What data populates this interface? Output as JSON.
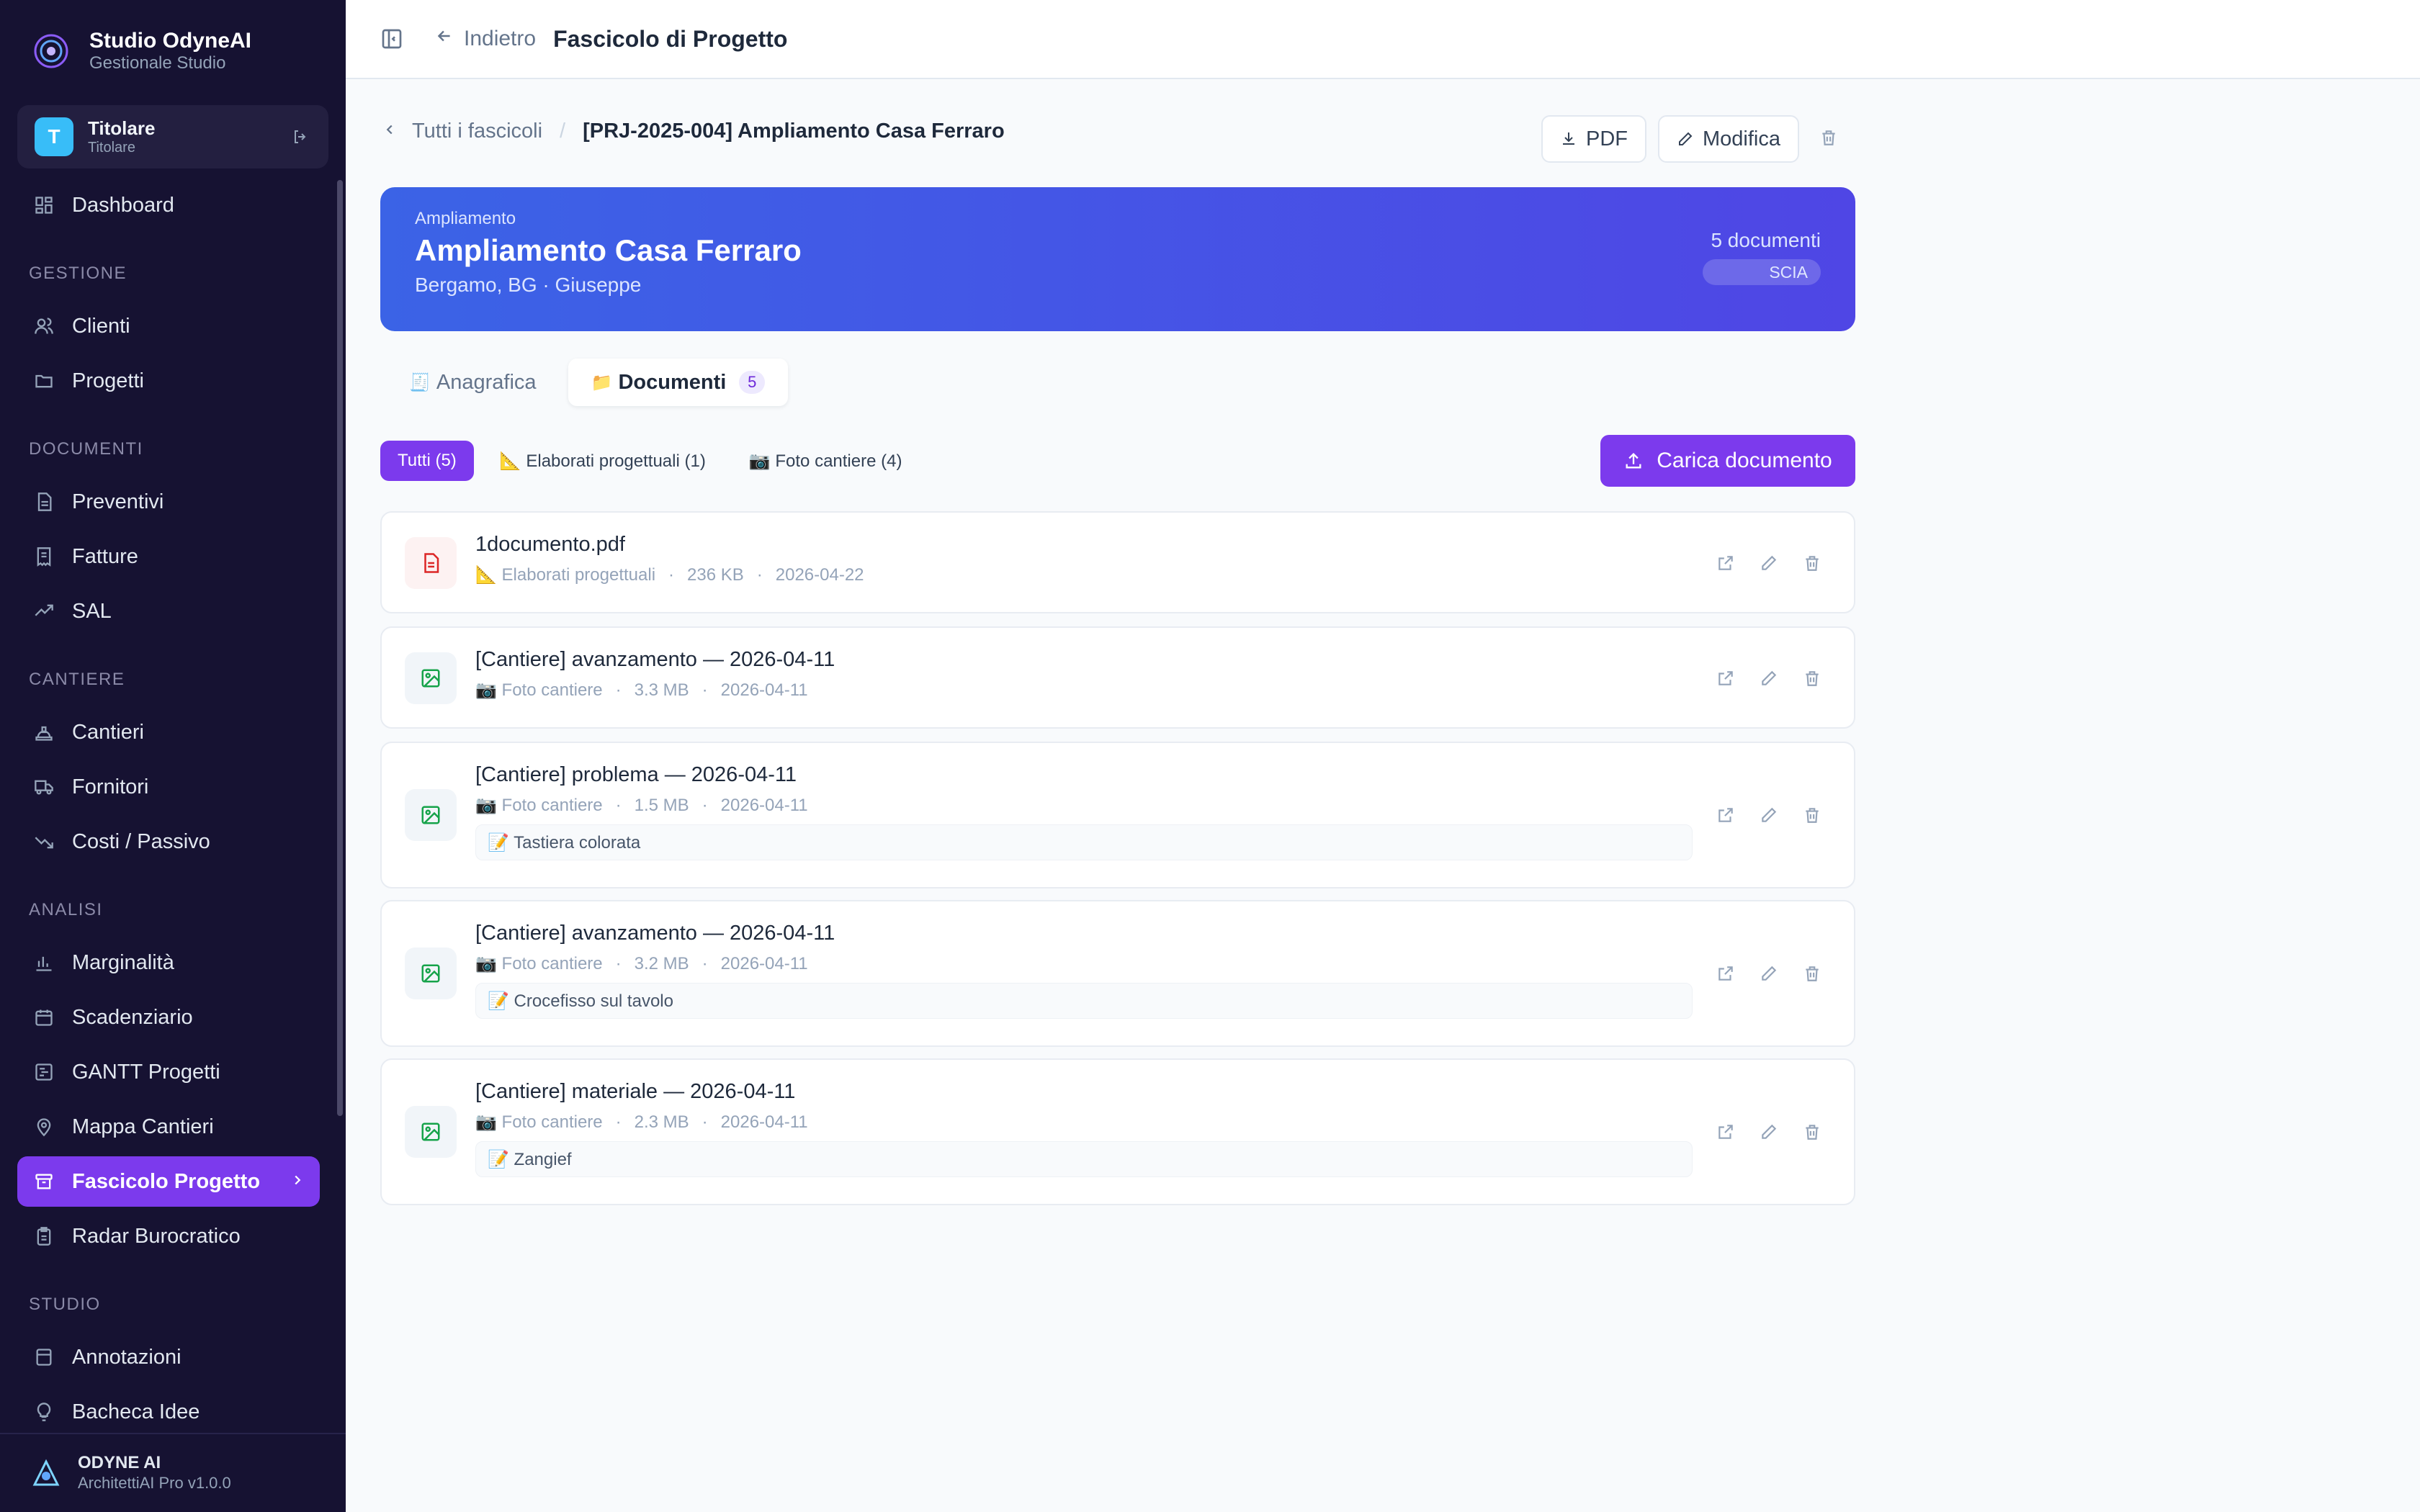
{
  "brand": {
    "name": "Studio OdyneAI",
    "subtitle": "Gestionale Studio"
  },
  "user": {
    "initial": "T",
    "name": "Titolare",
    "role": "Titolare"
  },
  "nav": {
    "dashboard": "Dashboard",
    "section_gestione": "GESTIONE",
    "clienti": "Clienti",
    "progetti": "Progetti",
    "section_documenti": "DOCUMENTI",
    "preventivi": "Preventivi",
    "fatture": "Fatture",
    "sal": "SAL",
    "section_cantiere": "CANTIERE",
    "cantieri": "Cantieri",
    "fornitori": "Fornitori",
    "costi": "Costi / Passivo",
    "section_analisi": "ANALISI",
    "marginalita": "Marginalità",
    "scadenziario": "Scadenziario",
    "gantt": "GANTT Progetti",
    "mappa": "Mappa Cantieri",
    "fascicolo": "Fascicolo Progetto",
    "radar": "Radar Burocratico",
    "section_studio": "STUDIO",
    "annotazioni": "Annotazioni",
    "bacheca": "Bacheca Idee"
  },
  "footer": {
    "name": "ODYNE AI",
    "version": "ArchitettiAI Pro v1.0.0"
  },
  "topbar": {
    "back_label": "Indietro",
    "title": "Fascicolo di Progetto"
  },
  "breadcrumb": {
    "back": "Tutti i fascicoli",
    "separator": "/",
    "current": "[PRJ-2025-004] Ampliamento Casa Ferraro"
  },
  "actions": {
    "pdf": "PDF",
    "edit": "Modifica"
  },
  "hero": {
    "type": "Ampliamento",
    "title": "Ampliamento Casa Ferraro",
    "location": "Bergamo, BG · Giuseppe",
    "count": "5 documenti",
    "badge": "SCIA"
  },
  "tabs": {
    "anagrafica": {
      "emoji": "🧾",
      "label": "Anagrafica"
    },
    "documenti": {
      "emoji": "📁",
      "label": "Documenti",
      "count": "5"
    }
  },
  "filters": {
    "all": "Tutti (5)",
    "elaborati": "📐 Elaborati progettuali (1)",
    "foto": "📷 Foto cantiere (4)"
  },
  "upload_label": "Carica documento",
  "documents": [
    {
      "title": "1documento.pdf",
      "category": "📐 Elaborati progettuali",
      "size": "236 KB",
      "date": "2026-04-22",
      "note": ""
    },
    {
      "title": "[Cantiere] avanzamento — 2026-04-11",
      "category": "📷 Foto cantiere",
      "size": "3.3 MB",
      "date": "2026-04-11",
      "note": ""
    },
    {
      "title": "[Cantiere] problema — 2026-04-11",
      "category": "📷 Foto cantiere",
      "size": "1.5 MB",
      "date": "2026-04-11",
      "note": "📝 Tastiera colorata"
    },
    {
      "title": "[Cantiere] avanzamento — 2026-04-11",
      "category": "📷 Foto cantiere",
      "size": "3.2 MB",
      "date": "2026-04-11",
      "note": "📝 Crocefisso sul tavolo"
    },
    {
      "title": "[Cantiere] materiale — 2026-04-11",
      "category": "📷 Foto cantiere",
      "size": "2.3 MB",
      "date": "2026-04-11",
      "note": "📝 Zangief"
    }
  ],
  "meta_separator": "·",
  "colors": {
    "sidebar": "#161232",
    "accent": "#7c3aed",
    "hero_start": "#3b63e6",
    "hero_end": "#4f46e5"
  }
}
